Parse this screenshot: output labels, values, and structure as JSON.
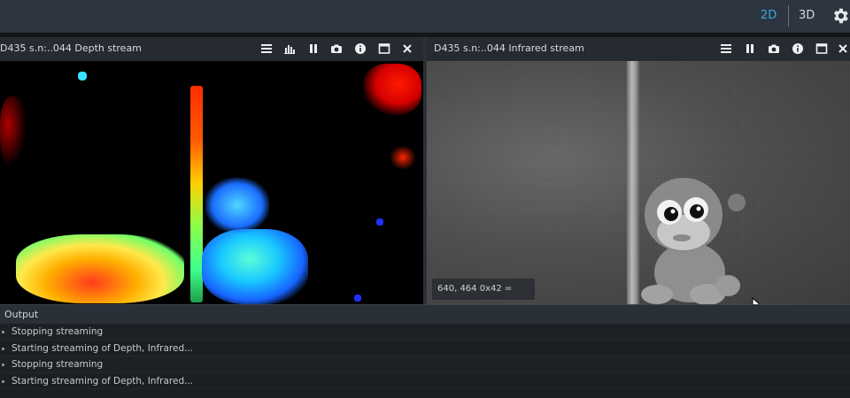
{
  "topbar": {
    "mode_2d": "2D",
    "mode_3d": "3D",
    "settings_icon": "gear-icon"
  },
  "depth_panel": {
    "title": "D435 s.n:..044 Depth stream",
    "controls": [
      "options-icon",
      "histogram-icon",
      "pause-icon",
      "camera-icon",
      "info-icon",
      "maximize-icon",
      "close-icon"
    ]
  },
  "ir_panel": {
    "title": "D435 s.n:..044 Infrared stream",
    "controls": [
      "options-icon",
      "pause-icon",
      "camera-icon",
      "info-icon",
      "maximize-icon",
      "close-icon"
    ],
    "pixel_readout": "640, 464 0x42 ="
  },
  "output": {
    "title": "Output",
    "entries": [
      "Stopping streaming",
      "Starting streaming of Depth, Infrared...",
      "Stopping streaming",
      "Starting streaming of Depth, Infrared..."
    ]
  },
  "colors": {
    "accent": "#3aa7df",
    "topbar": "#2d3640",
    "panel_header": "#252b31"
  }
}
